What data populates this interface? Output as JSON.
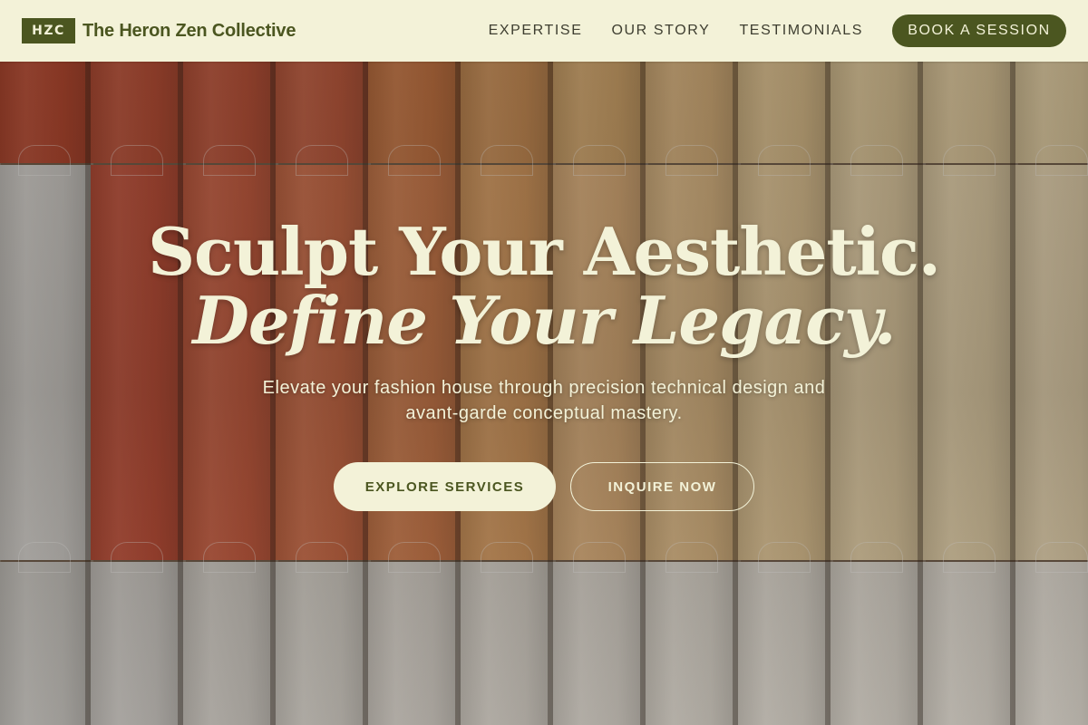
{
  "brand": {
    "badge": "HZC",
    "name": "The Heron Zen Collective"
  },
  "nav": {
    "items": [
      {
        "label": "EXPERTISE"
      },
      {
        "label": "OUR STORY"
      },
      {
        "label": "TESTIMONIALS"
      }
    ],
    "cta_label": "BOOK A SESSION"
  },
  "hero": {
    "headline_line1": "Sculpt Your Aesthetic.",
    "headline_line2": "Define Your Legacy.",
    "subtext": "Elevate your fashion house through precision technical design and avant-garde conceptual mastery.",
    "primary_cta": "EXPLORE SERVICES",
    "secondary_cta": "INQUIRE NOW",
    "background_image": "paint-swatch-cards-icon"
  },
  "colors": {
    "accent": "#4b5620",
    "cream": "#f3f2d8",
    "swatch_columns": [
      {
        "top": "#b5442c",
        "mid": "#d4d2cf",
        "bot": "#c9c7c3"
      },
      {
        "top": "#b84a32",
        "mid": "#c04c36",
        "bot": "#cdcac6"
      },
      {
        "top": "#ba4e35",
        "mid": "#c95a3e",
        "bot": "#d0ccc6"
      },
      {
        "top": "#bd563a",
        "mid": "#cd6844",
        "bot": "#d3cfc8"
      },
      {
        "top": "#c4713f",
        "mid": "#d07a4a",
        "bot": "#d5d0c9"
      },
      {
        "top": "#c98c53",
        "mid": "#d89a5e",
        "bot": "#d7d2ca"
      },
      {
        "top": "#d2a56a",
        "mid": "#dfb07a",
        "bot": "#d9d4cc"
      },
      {
        "top": "#d7b07a",
        "mid": "#e0bb86",
        "bot": "#dbd6cd"
      },
      {
        "top": "#dcbf8c",
        "mid": "#e3c796",
        "bot": "#ddd8cf"
      },
      {
        "top": "#ddc697",
        "mid": "#e5d0a6",
        "bot": "#ded9d0"
      },
      {
        "top": "#dfc99c",
        "mid": "#e6d3ab",
        "bot": "#e0dbd2"
      },
      {
        "top": "#e0cca0",
        "mid": "#e7d5b0",
        "bot": "#e2ddd4"
      }
    ]
  }
}
